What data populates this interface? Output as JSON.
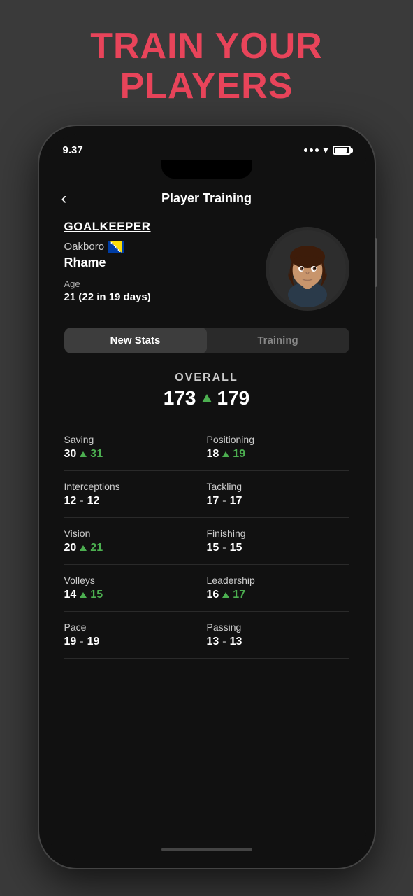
{
  "header": {
    "title": "TRAIN YOUR\nPLAYERS"
  },
  "statusBar": {
    "time": "9.37",
    "battery": 85
  },
  "nav": {
    "back": "‹",
    "title": "Player Training"
  },
  "player": {
    "position": "GOALKEEPER",
    "club": "Oakboro",
    "name": "Rhame",
    "age_label": "Age",
    "age_value": "21 (22 in 19 days)"
  },
  "tabs": [
    {
      "label": "New Stats",
      "active": true
    },
    {
      "label": "Training",
      "active": false
    }
  ],
  "overall": {
    "label": "OVERALL",
    "old": "173",
    "new": "179"
  },
  "stats": [
    {
      "label": "Saving",
      "old": "30",
      "new": "31",
      "increased": true
    },
    {
      "label": "Positioning",
      "old": "18",
      "new": "19",
      "increased": true
    },
    {
      "label": "Interceptions",
      "old": "12",
      "new": "12",
      "increased": false
    },
    {
      "label": "Tackling",
      "old": "17",
      "new": "17",
      "increased": false
    },
    {
      "label": "Vision",
      "old": "20",
      "new": "21",
      "increased": true
    },
    {
      "label": "Finishing",
      "old": "15",
      "new": "15",
      "increased": false
    },
    {
      "label": "Volleys",
      "old": "14",
      "new": "15",
      "increased": true
    },
    {
      "label": "Leadership",
      "old": "16",
      "new": "17",
      "increased": true
    },
    {
      "label": "Pace",
      "old": "19",
      "new": "19",
      "increased": false
    },
    {
      "label": "Passing",
      "old": "13",
      "new": "13",
      "increased": false
    }
  ]
}
